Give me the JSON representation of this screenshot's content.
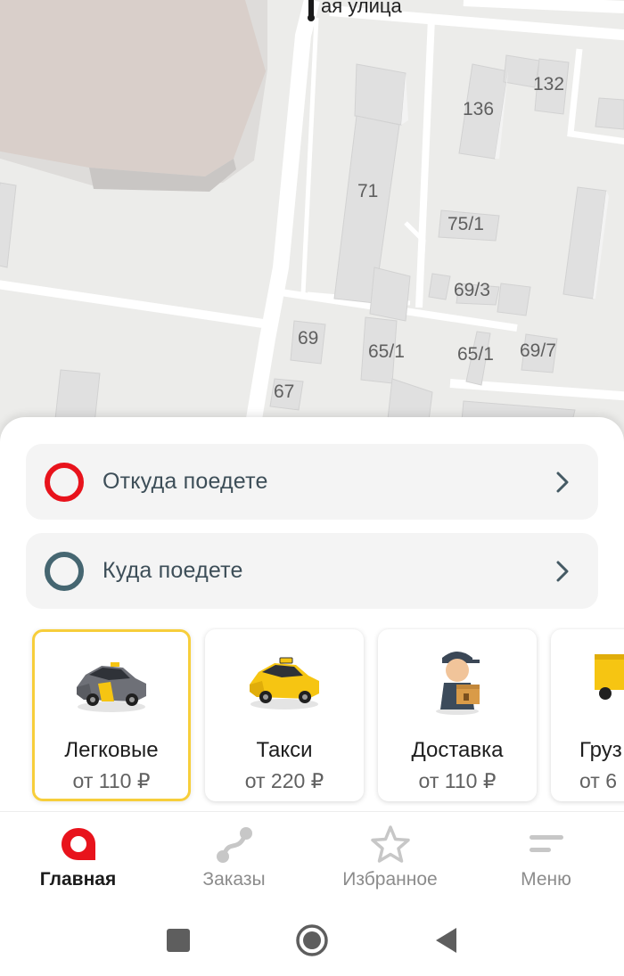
{
  "map": {
    "street_label": "ая улица",
    "house_numbers": [
      "132",
      "136",
      "71",
      "75/1",
      "69/3",
      "69",
      "65/1",
      "65/1",
      "69/7",
      "67"
    ]
  },
  "route": {
    "from": {
      "placeholder": "Откуда поедете",
      "ring_color": "#e8131c",
      "icon": "origin-ring-icon"
    },
    "to": {
      "placeholder": "Куда поедете",
      "ring_color": "#456671",
      "icon": "destination-ring-icon"
    }
  },
  "tariffs": [
    {
      "name": "Легковые",
      "price": "от 110 ₽",
      "icon": "passenger-car-icon",
      "selected": true
    },
    {
      "name": "Такси",
      "price": "от 220 ₽",
      "icon": "taxi-car-icon",
      "selected": false
    },
    {
      "name": "Доставка",
      "price": "от 110 ₽",
      "icon": "courier-icon",
      "selected": false
    },
    {
      "name": "Груз",
      "price": "от 6",
      "icon": "truck-icon",
      "selected": false
    }
  ],
  "nav": {
    "items": [
      {
        "label": "Главная",
        "icon": "home-pin-icon",
        "active": true
      },
      {
        "label": "Заказы",
        "icon": "route-orders-icon",
        "active": false
      },
      {
        "label": "Избранное",
        "icon": "star-icon",
        "active": false
      },
      {
        "label": "Меню",
        "icon": "menu-lines-icon",
        "active": false
      }
    ]
  },
  "colors": {
    "accent_red": "#e8131c",
    "selected_border": "#f7ce3b",
    "map_background": "#ececea"
  }
}
